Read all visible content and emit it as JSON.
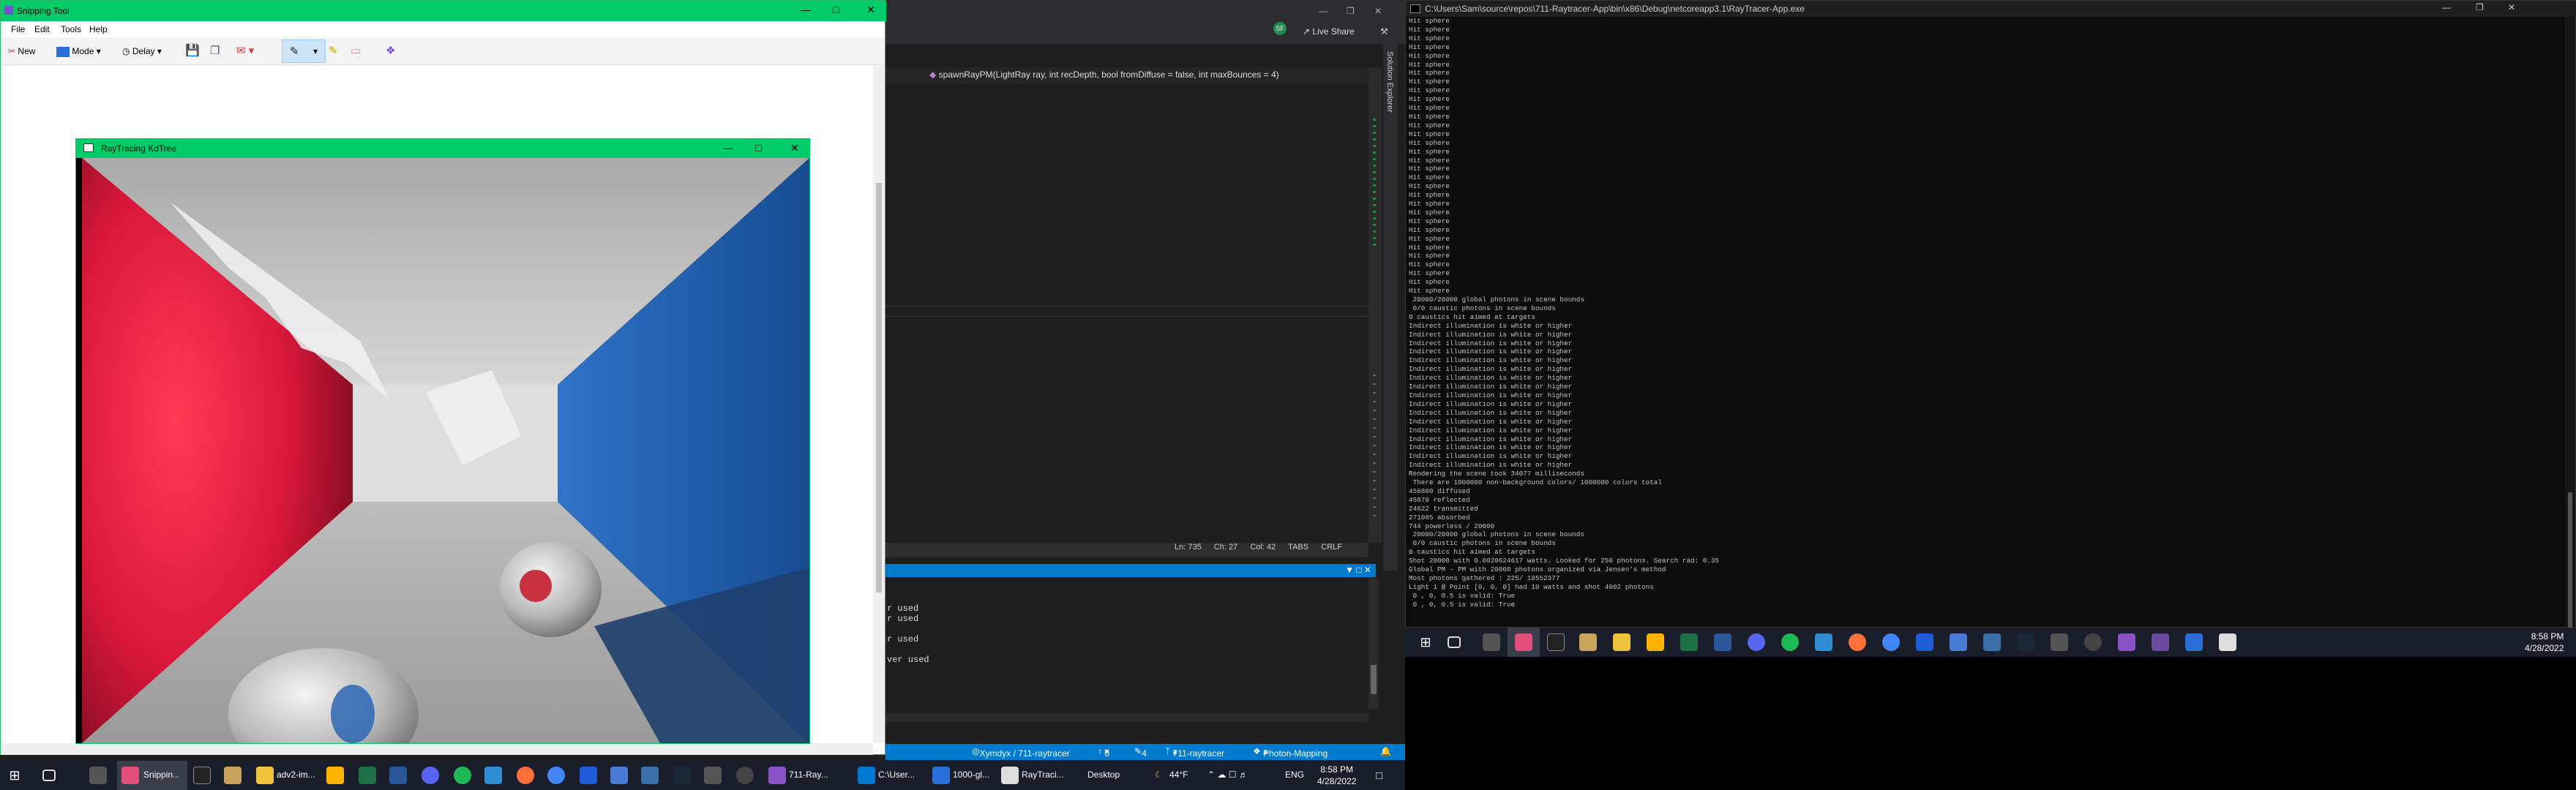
{
  "snipping_tool": {
    "title": "Snipping Tool",
    "menu": [
      "File",
      "Edit",
      "Tools",
      "Help"
    ],
    "toolbar": {
      "new": "New",
      "mode": "Mode",
      "delay": "Delay"
    }
  },
  "raytracer_window": {
    "title": "RayTracing KdTree"
  },
  "visual_studio": {
    "live_share": "Live Share",
    "avatar": "SF",
    "nav_signature": "spawnRayPM(LightRay ray, int recDepth, bool fromDiffuse = false, int maxBounces = 4)",
    "solution_explorer": "Solution Explorer",
    "status": {
      "ln": "Ln: 735",
      "ch": "Ch: 27",
      "col": "Col: 42",
      "tabs": "TABS",
      "crlf": "CRLF"
    },
    "output_lines": [
      "r used",
      "r used",
      "",
      "r used",
      "",
      "ver used"
    ],
    "bottom": {
      "repo": "Xymdyx / 711-raytracer",
      "up": "0",
      "pencil": "4",
      "branch": "711-raytracer",
      "project": "Photon-Mapping"
    }
  },
  "console": {
    "title": "C:\\Users\\Sam\\source\\repos\\711-Raytracer-App\\bin\\x86\\Debug\\netcoreapp3.1\\RayTracer-App.exe",
    "lines": [
      "Hit sphere",
      "Hit sphere",
      "Hit sphere",
      "Hit sphere",
      "Hit sphere",
      "Hit sphere",
      "Hit sphere",
      "Hit sphere",
      "Hit sphere",
      "Hit sphere",
      "Hit sphere",
      "Hit sphere",
      "Hit sphere",
      "Hit sphere",
      "Hit sphere",
      "Hit sphere",
      "Hit sphere",
      "Hit sphere",
      "Hit sphere",
      "Hit sphere",
      "Hit sphere",
      "Hit sphere",
      "Hit sphere",
      "Hit sphere",
      "Hit sphere",
      "Hit sphere",
      "Hit sphere",
      "Hit sphere",
      "Hit sphere",
      "Hit sphere",
      "Hit sphere",
      "Hit sphere",
      " 20000/20000 global photons in scene bounds",
      " 0/0 caustic photons in scene bounds",
      "0 caustics hit aimed at targets",
      "Indirect illumination is white or higher",
      "Indirect illumination is white or higher",
      "Indirect illumination is white or higher",
      "Indirect illumination is white or higher",
      "Indirect illumination is white or higher",
      "Indirect illumination is white or higher",
      "Indirect illumination is white or higher",
      "Indirect illumination is white or higher",
      "Indirect illumination is white or higher",
      "Indirect illumination is white or higher",
      "Indirect illumination is white or higher",
      "Indirect illumination is white or higher",
      "Indirect illumination is white or higher",
      "Indirect illumination is white or higher",
      "Indirect illumination is white or higher",
      "Indirect illumination is white or higher",
      "Indirect illumination is white or higher",
      "Rendering the scene took 34077 milliseconds",
      " There are 1000000 non-background colors/ 1000000 colors total",
      "456800 diffused",
      "45870 reflected",
      "24622 transmitted",
      "271085 absorbed",
      "744 powerless / 20000",
      " 20000/20000 global photons in scene bounds",
      " 0/0 caustic photons in scene bounds",
      "0 caustics hit aimed at targets",
      "Shot 20000 with 0.0020624617 watts. Looked for 250 photons. Search rad: 0.35",
      "Global PM - PM with 20000 photons organized via Jensen's method",
      "Most photons gathered : 225/ 18552377",
      "Light 1 @ Point [0, 0, 0] had 10 watts and shot 4002 photons",
      " 0 , 0, 0.5 is valid: True",
      " 0 , 0, 0.5 is valid: True"
    ]
  },
  "taskbar1": {
    "items": [
      "Snippin...",
      "adv2-im...",
      "711-Ray...",
      "C:\\User...",
      "1000-gl...",
      "RayTraci..."
    ],
    "desktop": "Desktop",
    "temp": "44°F",
    "lang": "ENG",
    "time": "8:58 PM",
    "date": "4/28/2022"
  },
  "taskbar2": {
    "time": "8:58 PM",
    "date": "4/28/2022"
  },
  "colors": {
    "accent_green": "#00cc6a",
    "vs_blue": "#007acc",
    "red_wall": "#d8173a",
    "blue_wall": "#1f5aa8"
  }
}
